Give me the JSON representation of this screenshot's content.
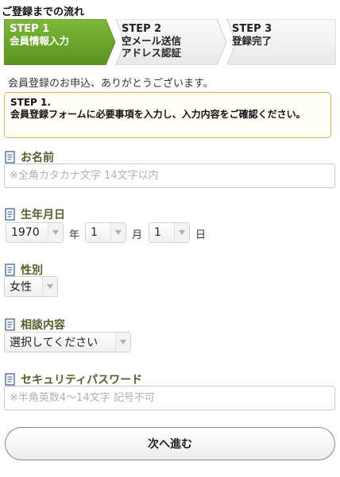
{
  "flow_title": "ご登録までの流れ",
  "steps": [
    {
      "num": "STEP 1",
      "line1": "会員情報入力",
      "line2": "",
      "active": true
    },
    {
      "num": "STEP 2",
      "line1": "空メール送信",
      "line2": "アドレス認証",
      "active": false
    },
    {
      "num": "STEP 3",
      "line1": "登録完了",
      "line2": "",
      "active": false
    }
  ],
  "welcome_text": "会員登録のお申込、ありがとうございます。",
  "notice": {
    "title": "STEP 1.",
    "body": "会員登録フォームに必要事項を入力し、入力内容をご確認ください。"
  },
  "form": {
    "name": {
      "label": "お名前",
      "placeholder": "※全角カタカナ文字 14文字以内"
    },
    "birthdate": {
      "label": "生年月日",
      "year": "1970",
      "year_unit": "年",
      "month": "1",
      "month_unit": "月",
      "day": "1",
      "day_unit": "日"
    },
    "gender": {
      "label": "性別",
      "value": "女性"
    },
    "consult": {
      "label": "相談内容",
      "value": "選択してください"
    },
    "password": {
      "label": "セキュリティパスワード",
      "placeholder": "※半角英数4〜14文字 記号不可"
    }
  },
  "next_button": "次へ進む",
  "colors": {
    "step_active": "#6aa22e",
    "step_inactive": "#f1f1f1",
    "label_green": "#4f6228",
    "notice_border": "#e0b04a"
  }
}
